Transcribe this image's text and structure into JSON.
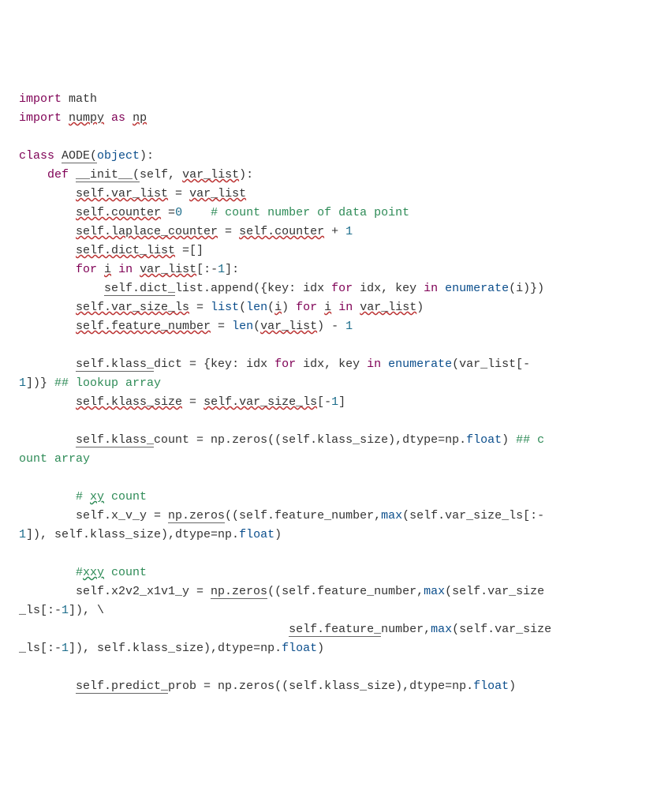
{
  "lines": [
    [
      {
        "t": "import ",
        "cls": "kw"
      },
      {
        "t": "math",
        "cls": "id"
      }
    ],
    [
      {
        "t": "import ",
        "cls": "kw"
      },
      {
        "t": "numpy",
        "cls": "dec"
      },
      {
        "t": " ",
        "cls": ""
      },
      {
        "t": "as ",
        "cls": "kw"
      },
      {
        "t": "np",
        "cls": "dec"
      }
    ],
    [],
    [
      {
        "t": "class ",
        "cls": "kw"
      },
      {
        "t": "AODE(",
        "cls": "uline"
      },
      {
        "t": "object",
        "cls": "bi"
      },
      {
        "t": "):",
        "cls": ""
      }
    ],
    [
      {
        "t": "    ",
        "cls": ""
      },
      {
        "t": "def ",
        "cls": "kw"
      },
      {
        "t": "__init__(",
        "cls": "uline"
      },
      {
        "t": "self, ",
        "cls": ""
      },
      {
        "t": "var_list",
        "cls": "dec"
      },
      {
        "t": "):",
        "cls": ""
      }
    ],
    [
      {
        "t": "        ",
        "cls": ""
      },
      {
        "t": "self.var_list",
        "cls": "dec"
      },
      {
        "t": " = ",
        "cls": ""
      },
      {
        "t": "var_list",
        "cls": "dec"
      }
    ],
    [
      {
        "t": "        ",
        "cls": ""
      },
      {
        "t": "self.counter",
        "cls": "dec"
      },
      {
        "t": " =",
        "cls": ""
      },
      {
        "t": "0",
        "cls": "num"
      },
      {
        "t": "    ",
        "cls": ""
      },
      {
        "t": "# count number of data point",
        "cls": "cmt"
      }
    ],
    [
      {
        "t": "        ",
        "cls": ""
      },
      {
        "t": "self.laplace_counter",
        "cls": "dec"
      },
      {
        "t": " = ",
        "cls": ""
      },
      {
        "t": "self.counter",
        "cls": "dec"
      },
      {
        "t": " + ",
        "cls": ""
      },
      {
        "t": "1",
        "cls": "num"
      }
    ],
    [
      {
        "t": "        ",
        "cls": ""
      },
      {
        "t": "self.dict_list",
        "cls": "dec"
      },
      {
        "t": " =[]",
        "cls": ""
      }
    ],
    [
      {
        "t": "        ",
        "cls": ""
      },
      {
        "t": "for ",
        "cls": "kw"
      },
      {
        "t": "i",
        "cls": "dec"
      },
      {
        "t": " ",
        "cls": ""
      },
      {
        "t": "in ",
        "cls": "kw"
      },
      {
        "t": "var_list",
        "cls": "dec"
      },
      {
        "t": "[:-",
        "cls": ""
      },
      {
        "t": "1",
        "cls": "num"
      },
      {
        "t": "]:",
        "cls": ""
      }
    ],
    [
      {
        "t": "            ",
        "cls": ""
      },
      {
        "t": "self.dict_",
        "cls": "uline"
      },
      {
        "t": "list.append({key: idx ",
        "cls": ""
      },
      {
        "t": "for ",
        "cls": "kw"
      },
      {
        "t": "idx, key ",
        "cls": ""
      },
      {
        "t": "in ",
        "cls": "kw"
      },
      {
        "t": "enumerate",
        "cls": "bi"
      },
      {
        "t": "(i)})",
        "cls": ""
      }
    ],
    [
      {
        "t": "        ",
        "cls": ""
      },
      {
        "t": "self.var_size_ls",
        "cls": "dec"
      },
      {
        "t": " = ",
        "cls": ""
      },
      {
        "t": "list",
        "cls": "bi"
      },
      {
        "t": "(",
        "cls": ""
      },
      {
        "t": "len",
        "cls": "bi"
      },
      {
        "t": "(",
        "cls": ""
      },
      {
        "t": "i",
        "cls": "dec"
      },
      {
        "t": ") ",
        "cls": ""
      },
      {
        "t": "for ",
        "cls": "kw"
      },
      {
        "t": "i",
        "cls": "dec"
      },
      {
        "t": " ",
        "cls": ""
      },
      {
        "t": "in ",
        "cls": "kw"
      },
      {
        "t": "var_list",
        "cls": "dec"
      },
      {
        "t": ")",
        "cls": ""
      }
    ],
    [
      {
        "t": "        ",
        "cls": ""
      },
      {
        "t": "self.feature_number",
        "cls": "dec"
      },
      {
        "t": " = ",
        "cls": ""
      },
      {
        "t": "len",
        "cls": "bi"
      },
      {
        "t": "(",
        "cls": ""
      },
      {
        "t": "var_list",
        "cls": "dec"
      },
      {
        "t": ") - ",
        "cls": ""
      },
      {
        "t": "1",
        "cls": "num"
      }
    ],
    [],
    [
      {
        "t": "        ",
        "cls": ""
      },
      {
        "t": "self.klass_",
        "cls": "uline"
      },
      {
        "t": "dict = {key: idx ",
        "cls": ""
      },
      {
        "t": "for ",
        "cls": "kw"
      },
      {
        "t": "idx, key ",
        "cls": ""
      },
      {
        "t": "in ",
        "cls": "kw"
      },
      {
        "t": "enumerate",
        "cls": "bi"
      },
      {
        "t": "(var_list[-",
        "cls": ""
      }
    ],
    [
      {
        "t": "1",
        "cls": "num"
      },
      {
        "t": "])} ",
        "cls": ""
      },
      {
        "t": "## lookup array",
        "cls": "cmt"
      }
    ],
    [
      {
        "t": "        ",
        "cls": ""
      },
      {
        "t": "self.klass_size",
        "cls": "dec"
      },
      {
        "t": " = ",
        "cls": ""
      },
      {
        "t": "self.var_size_ls",
        "cls": "dec"
      },
      {
        "t": "[-",
        "cls": ""
      },
      {
        "t": "1",
        "cls": "num"
      },
      {
        "t": "]",
        "cls": ""
      }
    ],
    [],
    [
      {
        "t": "        ",
        "cls": ""
      },
      {
        "t": "self.klass_",
        "cls": "uline"
      },
      {
        "t": "count = np.zeros((self.klass_size),dtype=np.",
        "cls": ""
      },
      {
        "t": "float",
        "cls": "bi"
      },
      {
        "t": ") ",
        "cls": ""
      },
      {
        "t": "## c",
        "cls": "cmt"
      }
    ],
    [
      {
        "t": "ount array",
        "cls": "cmt"
      }
    ],
    [],
    [
      {
        "t": "        ",
        "cls": ""
      },
      {
        "t": "# ",
        "cls": "cmt"
      },
      {
        "t": "xy",
        "cls": "cmt decg"
      },
      {
        "t": " count",
        "cls": "cmt"
      }
    ],
    [
      {
        "t": "        self.x_v_y = ",
        "cls": ""
      },
      {
        "t": "np.zeros",
        "cls": "uline"
      },
      {
        "t": "((self.feature_number,",
        "cls": ""
      },
      {
        "t": "max",
        "cls": "bi"
      },
      {
        "t": "(self.var_size_ls[:-",
        "cls": ""
      }
    ],
    [
      {
        "t": "1",
        "cls": "num"
      },
      {
        "t": "]), self.klass_size),dtype=np.",
        "cls": ""
      },
      {
        "t": "float",
        "cls": "bi"
      },
      {
        "t": ")",
        "cls": ""
      }
    ],
    [],
    [
      {
        "t": "        ",
        "cls": ""
      },
      {
        "t": "#",
        "cls": "cmt"
      },
      {
        "t": "xxy",
        "cls": "cmt decg"
      },
      {
        "t": " count",
        "cls": "cmt"
      }
    ],
    [
      {
        "t": "        self.x2v2_x1v1_y = ",
        "cls": ""
      },
      {
        "t": "np.zeros",
        "cls": "uline"
      },
      {
        "t": "((self.feature_number,",
        "cls": ""
      },
      {
        "t": "max",
        "cls": "bi"
      },
      {
        "t": "(self.var_size",
        "cls": ""
      }
    ],
    [
      {
        "t": "_ls[:-",
        "cls": ""
      },
      {
        "t": "1",
        "cls": "num"
      },
      {
        "t": "]), \\",
        "cls": ""
      }
    ],
    [
      {
        "t": "                                      ",
        "cls": ""
      },
      {
        "t": "self.feature_",
        "cls": "uline"
      },
      {
        "t": "number,",
        "cls": ""
      },
      {
        "t": "max",
        "cls": "bi"
      },
      {
        "t": "(self.var_size",
        "cls": ""
      }
    ],
    [
      {
        "t": "_ls[:-",
        "cls": ""
      },
      {
        "t": "1",
        "cls": "num"
      },
      {
        "t": "]), self.klass_size),dtype=np.",
        "cls": ""
      },
      {
        "t": "float",
        "cls": "bi"
      },
      {
        "t": ")",
        "cls": ""
      }
    ],
    [],
    [
      {
        "t": "        ",
        "cls": ""
      },
      {
        "t": "self.predict_",
        "cls": "uline"
      },
      {
        "t": "prob = np.zeros((self.klass_size),dtype=np.",
        "cls": ""
      },
      {
        "t": "float",
        "cls": "bi"
      },
      {
        "t": ")",
        "cls": ""
      }
    ]
  ]
}
